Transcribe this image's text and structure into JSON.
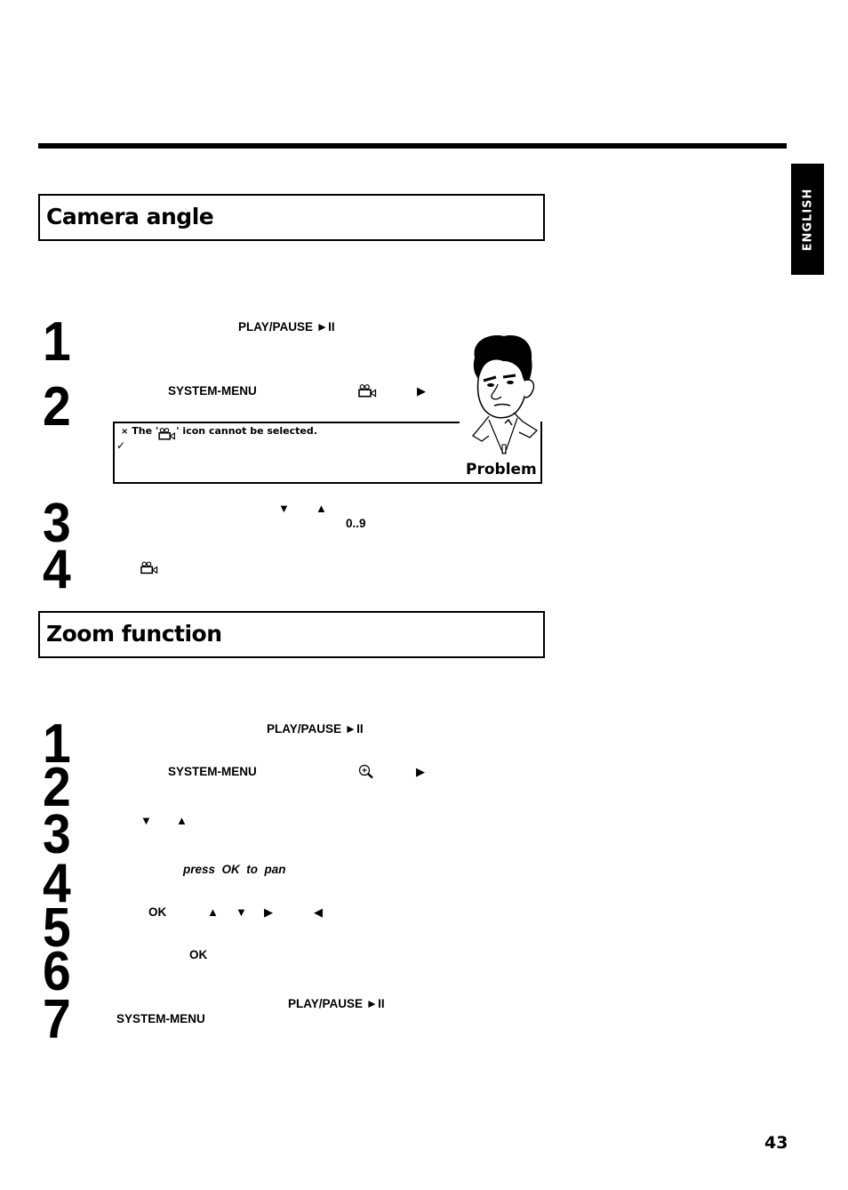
{
  "page": {
    "language_tab": "ENGLISH",
    "page_number": "43"
  },
  "camera_angle": {
    "title": "Camera angle",
    "steps": [
      {
        "number": "1",
        "keys": [
          "PLAY/PAUSE ►II"
        ]
      },
      {
        "number": "2",
        "keys": [
          "SYSTEM-MENU",
          "camera-angle-icon",
          "▶"
        ]
      },
      {
        "number": "3",
        "keys": [
          "▼",
          "▲",
          "0..9"
        ]
      },
      {
        "number": "4",
        "keys": [
          "camera-angle-icon"
        ]
      }
    ],
    "problem": {
      "bullet": "×",
      "text_before": "The '",
      "text_after": "' icon cannot be selected.",
      "check": "✓",
      "label": "Problem"
    }
  },
  "zoom_function": {
    "title": "Zoom function",
    "steps": [
      {
        "number": "1",
        "keys": [
          "PLAY/PAUSE ►II"
        ]
      },
      {
        "number": "2",
        "keys": [
          "SYSTEM-MENU",
          "zoom-icon",
          "▶"
        ]
      },
      {
        "number": "3",
        "keys": [
          "▼",
          "▲"
        ]
      },
      {
        "number": "4",
        "keys": [
          "press  OK  to  pan"
        ]
      },
      {
        "number": "5",
        "keys": [
          "OK",
          "▲",
          "▼",
          "▶",
          "◀"
        ]
      },
      {
        "number": "6",
        "keys": [
          "OK"
        ]
      },
      {
        "number": "7",
        "keys": [
          "PLAY/PAUSE ►II",
          "SYSTEM-MENU"
        ]
      }
    ]
  }
}
